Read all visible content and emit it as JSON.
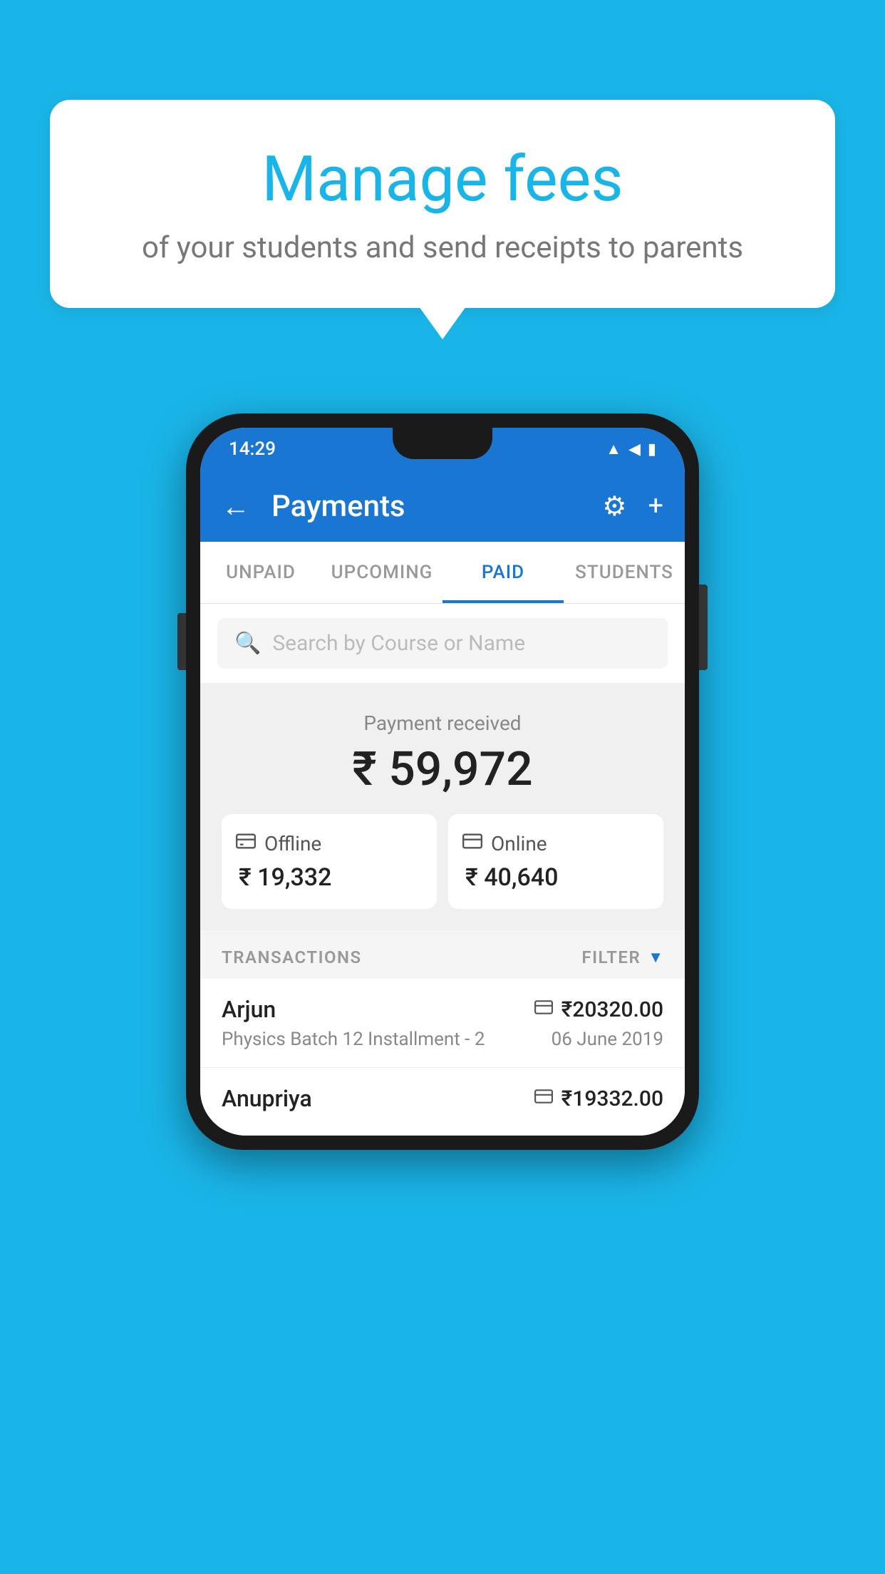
{
  "background_color": "#1ab5e8",
  "speech_bubble": {
    "title": "Manage fees",
    "subtitle": "of your students and send receipts to parents"
  },
  "phone": {
    "status_bar": {
      "time": "14:29",
      "icons": [
        "▲",
        "◀",
        "▮"
      ]
    },
    "app_bar": {
      "back_icon": "←",
      "title": "Payments",
      "settings_icon": "⚙",
      "add_icon": "+"
    },
    "tabs": [
      {
        "label": "UNPAID",
        "active": false
      },
      {
        "label": "UPCOMING",
        "active": false
      },
      {
        "label": "PAID",
        "active": true
      },
      {
        "label": "STUDENTS",
        "active": false
      }
    ],
    "search": {
      "placeholder": "Search by Course or Name",
      "icon": "🔍"
    },
    "payment_received": {
      "label": "Payment received",
      "amount": "₹ 59,972",
      "offline": {
        "icon": "💳",
        "label": "Offline",
        "amount": "₹ 19,332"
      },
      "online": {
        "icon": "💳",
        "label": "Online",
        "amount": "₹ 40,640"
      }
    },
    "transactions_header": {
      "label": "TRANSACTIONS",
      "filter_label": "FILTER",
      "filter_icon": "▼"
    },
    "transactions": [
      {
        "name": "Arjun",
        "icon": "💳",
        "amount": "₹20320.00",
        "description": "Physics Batch 12 Installment - 2",
        "date": "06 June 2019"
      },
      {
        "name": "Anupriya",
        "icon": "💳",
        "amount": "₹19332.00",
        "description": "",
        "date": ""
      }
    ]
  }
}
